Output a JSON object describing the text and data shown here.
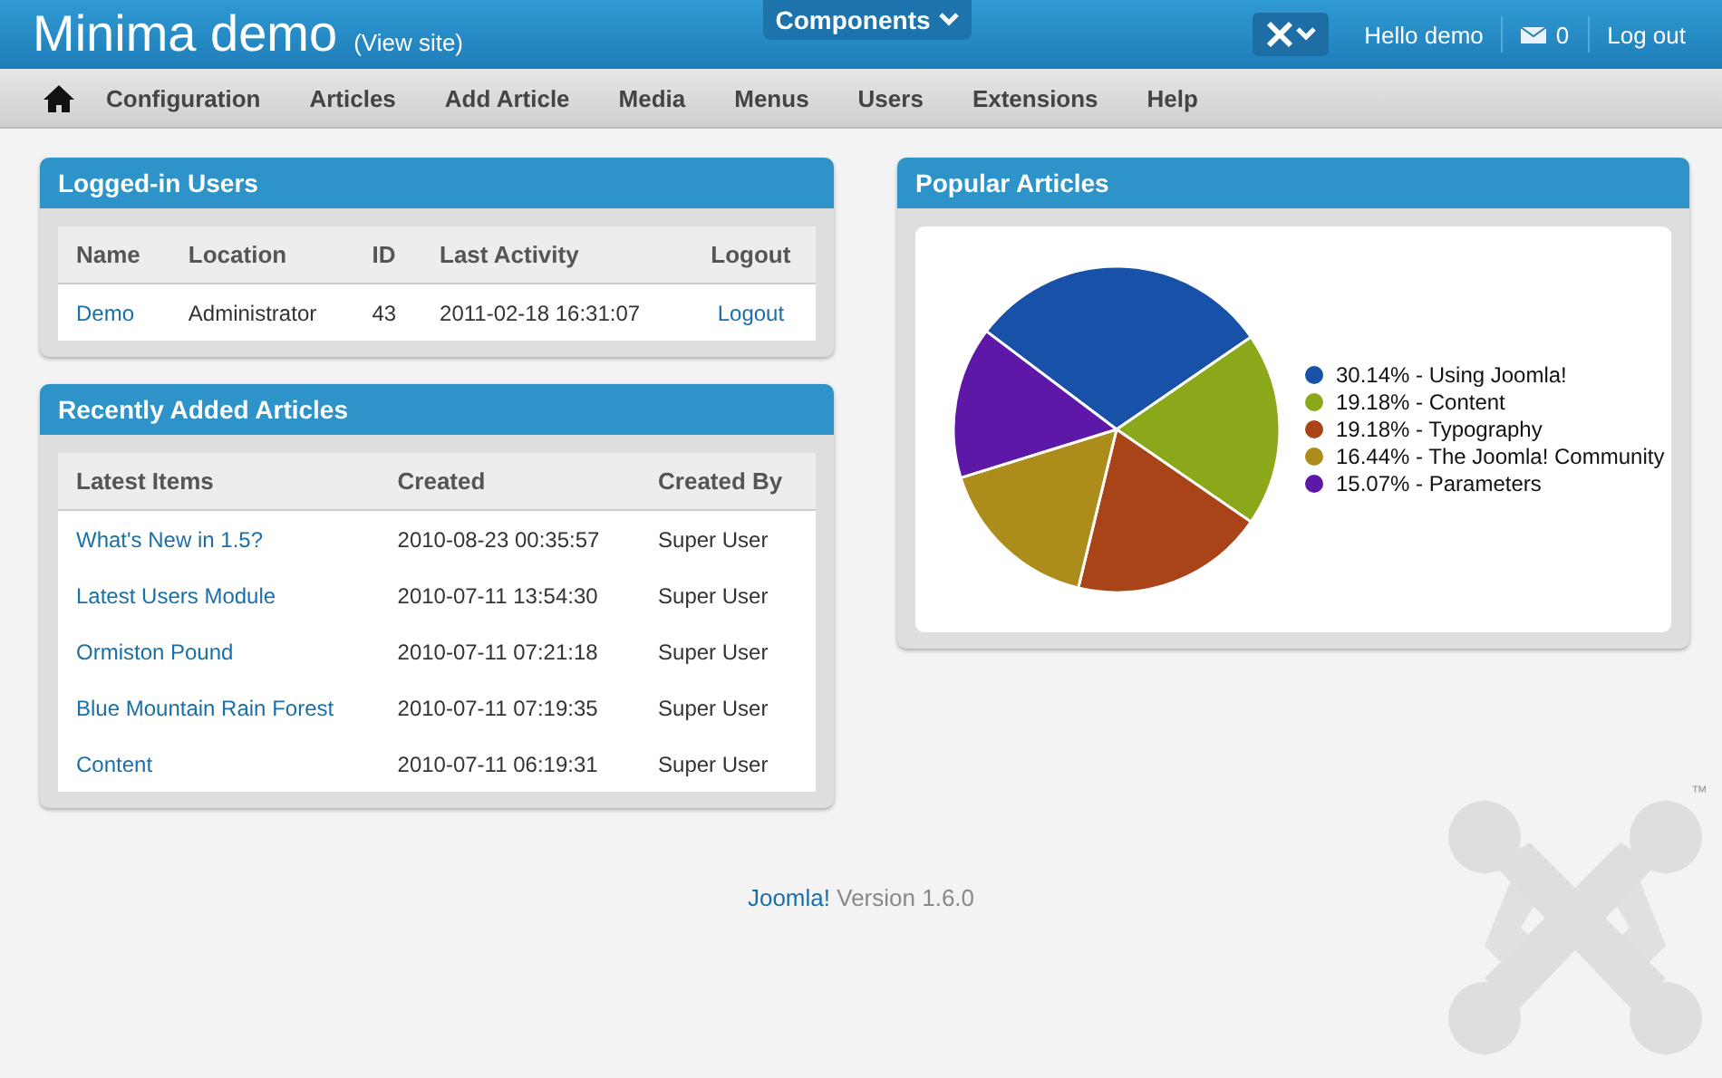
{
  "header": {
    "site_title": "Minima demo",
    "view_site": "(View site)",
    "menu_button": "Components",
    "greeting": "Hello demo",
    "messages_count": "0",
    "logout": "Log out"
  },
  "nav": {
    "items": [
      "Configuration",
      "Articles",
      "Add Article",
      "Media",
      "Menus",
      "Users",
      "Extensions",
      "Help"
    ]
  },
  "logged_in_users": {
    "title": "Logged-in Users",
    "columns": [
      "Name",
      "Location",
      "ID",
      "Last Activity",
      "Logout"
    ],
    "rows": [
      {
        "name": "Demo",
        "location": "Administrator",
        "id": "43",
        "last_activity": "2011-02-18 16:31:07",
        "logout": "Logout"
      }
    ]
  },
  "recent_articles": {
    "title": "Recently Added Articles",
    "columns": [
      "Latest Items",
      "Created",
      "Created By"
    ],
    "rows": [
      {
        "title": "What's New in 1.5?",
        "created": "2010-08-23 00:35:57",
        "created_by": "Super User"
      },
      {
        "title": "Latest Users Module",
        "created": "2010-07-11 13:54:30",
        "created_by": "Super User"
      },
      {
        "title": "Ormiston Pound",
        "created": "2010-07-11 07:21:18",
        "created_by": "Super User"
      },
      {
        "title": "Blue Mountain Rain Forest",
        "created": "2010-07-11 07:19:35",
        "created_by": "Super User"
      },
      {
        "title": "Content",
        "created": "2010-07-11 06:19:31",
        "created_by": "Super User"
      }
    ]
  },
  "popular_articles": {
    "title": "Popular Articles",
    "chart_data": {
      "type": "pie",
      "values": [
        30.14,
        19.18,
        19.18,
        16.44,
        15.07
      ],
      "colors": [
        "#1852a8",
        "#8aa81a",
        "#a84418",
        "#ac8c1a",
        "#5e18a8"
      ],
      "legend": "right",
      "categories": [
        "30.14% - Using Joomla!",
        "19.18% - Content",
        "19.18% - Typography",
        "16.44% - The Joomla! Community",
        "15.07% - Parameters"
      ]
    }
  },
  "footer": {
    "link": "Joomla!",
    "version": "Version 1.6.0"
  },
  "watermark_mark": "™"
}
